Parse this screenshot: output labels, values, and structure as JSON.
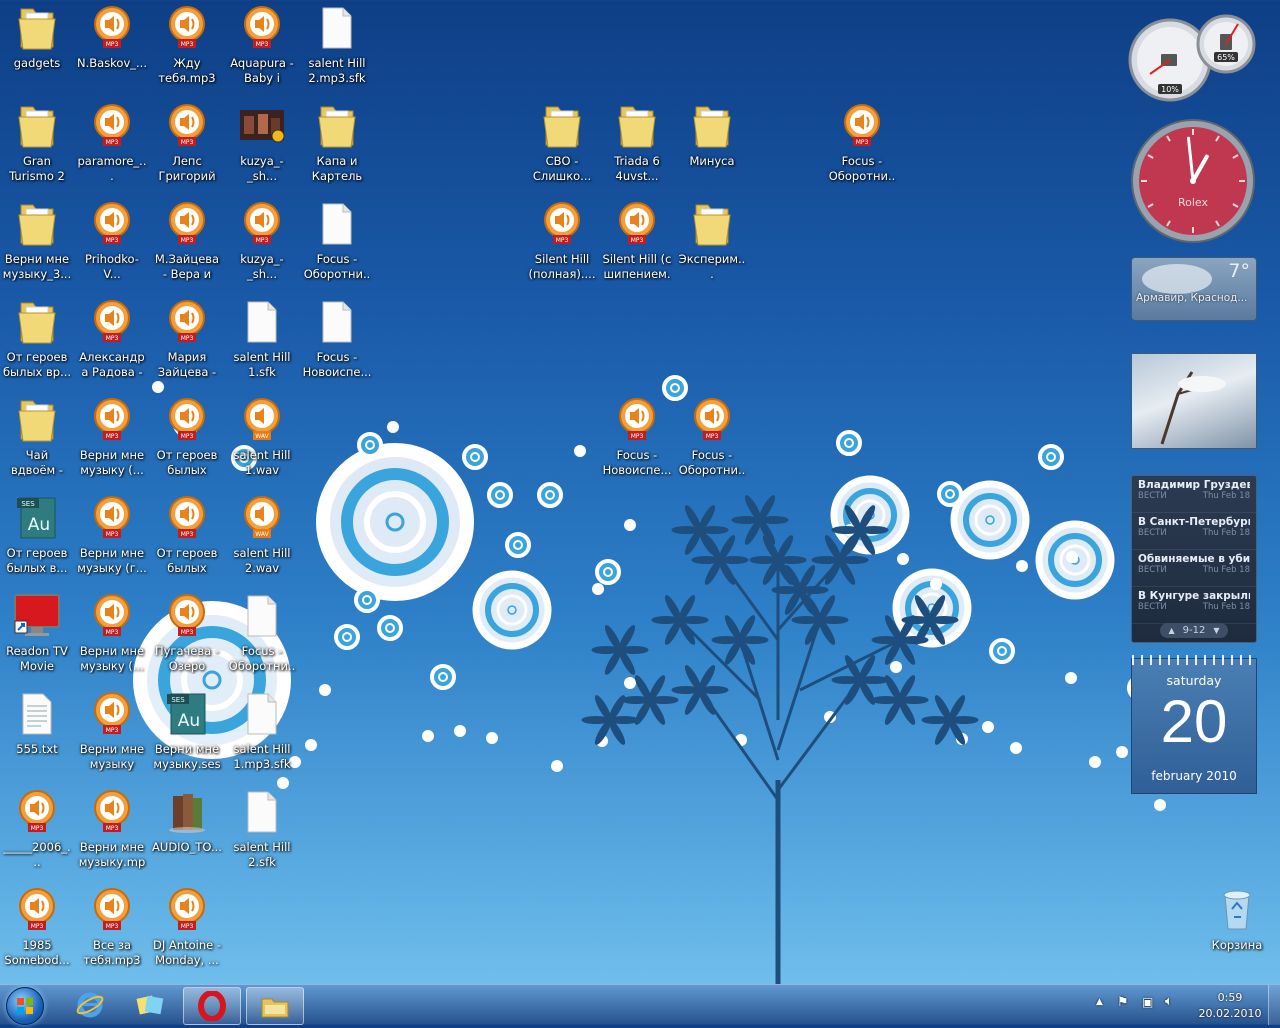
{
  "desktop": {
    "icons": [
      {
        "label": "gadgets",
        "type": "folder"
      },
      {
        "label": "N.Baskov_...",
        "type": "mp3"
      },
      {
        "label": "Жду тебя.mp3",
        "type": "mp3"
      },
      {
        "label": "Aquapura - Baby i thin...",
        "type": "mp3"
      },
      {
        "label": "salent Hill 2.mp3.sfk",
        "type": "file"
      },
      {
        "label": "Gran Turismo 2 [...",
        "type": "folder"
      },
      {
        "label": "paramore_...",
        "type": "mp3"
      },
      {
        "label": "Лепс Григорий -...",
        "type": "mp3"
      },
      {
        "label": "kuzya_-_sh...",
        "type": "video"
      },
      {
        "label": "Капа и Картель",
        "type": "folder"
      },
      {
        "label": "СВО - Слишко...",
        "type": "folder"
      },
      {
        "label": "Triada 6 4uvst...",
        "type": "folder"
      },
      {
        "label": "Минуса",
        "type": "folder"
      },
      {
        "label": "Focus - Оборотни...",
        "type": "mp3"
      },
      {
        "label": "Верни мне музыку_3...",
        "type": "folder"
      },
      {
        "label": "Prihodko-V...",
        "type": "mp3"
      },
      {
        "label": "М.Зайцева - Вера и лю...",
        "type": "mp3"
      },
      {
        "label": "kuzya_-_sh...",
        "type": "mp3"
      },
      {
        "label": "Focus - Оборотни...",
        "type": "file"
      },
      {
        "label": "Silent Hill (полная)....",
        "type": "mp3"
      },
      {
        "label": "Silent Hill (с шипением...",
        "type": "mp3"
      },
      {
        "label": "Эксперим...",
        "type": "folder"
      },
      {
        "label": "От героев былых вр...",
        "type": "folder"
      },
      {
        "label": "Александра Радова - ...",
        "type": "mp3"
      },
      {
        "label": "Мария Зайцева - ...",
        "type": "mp3"
      },
      {
        "label": "salent Hill 1.sfk",
        "type": "file"
      },
      {
        "label": "Focus - Новоиспе...",
        "type": "file"
      },
      {
        "label": "Чай вдвоём - День ро...",
        "type": "folder"
      },
      {
        "label": "Верни мне музыку (...",
        "type": "mp3"
      },
      {
        "label": "От героев былых вре...",
        "type": "mp3"
      },
      {
        "label": "salent Hill 1.wav",
        "type": "wav"
      },
      {
        "label": "Focus - Новоиспе...",
        "type": "mp3"
      },
      {
        "label": "Focus - Оборотни...",
        "type": "mp3"
      },
      {
        "label": "От героев былых в...",
        "type": "ses"
      },
      {
        "label": "Верни мне музыку (г...",
        "type": "mp3"
      },
      {
        "label": "От героев былых вре...",
        "type": "mp3"
      },
      {
        "label": "salent Hill 2.wav",
        "type": "wav"
      },
      {
        "label": "Readon TV Movie Rad...",
        "type": "app"
      },
      {
        "label": "Верни мне музыку (...",
        "type": "mp3"
      },
      {
        "label": "Пугачева - Озеро над...",
        "type": "mp3"
      },
      {
        "label": "Focus - Оборотни...",
        "type": "file"
      },
      {
        "label": "555.txt",
        "type": "txt"
      },
      {
        "label": "Верни мне музыку (го...",
        "type": "mp3"
      },
      {
        "label": "Верни мне музыку.ses",
        "type": "ses"
      },
      {
        "label": "salent Hill 1.mp3.sfk",
        "type": "file"
      },
      {
        "label": "_____2006_...",
        "type": "mp3"
      },
      {
        "label": "Верни мне музыку.mp3",
        "type": "mp3"
      },
      {
        "label": "AUDIO_TO...",
        "type": "books"
      },
      {
        "label": "salent Hill 2.sfk",
        "type": "file"
      },
      {
        "label": "1985 Somebod...",
        "type": "mp3"
      },
      {
        "label": "Все за тебя.mp3",
        "type": "mp3"
      },
      {
        "label": "DJ Antoine - Monday, ...",
        "type": "mp3"
      },
      {
        "label": "Корзина",
        "type": "recycle"
      }
    ]
  },
  "gadgets": {
    "cpu_meter": {
      "cpu_label": "10%",
      "ram_label": "65%",
      "cpu_value": 10,
      "ram_value": 65
    },
    "clock": {
      "brand": "Rolex",
      "hour": 0,
      "minute": 59
    },
    "weather": {
      "temp": "7°",
      "location": "Армавир, Краснод..."
    },
    "news": {
      "items": [
        {
          "title": "Владимир Груздев:...",
          "source": "ВЕСТИ",
          "date": "Thu Feb 18"
        },
        {
          "title": "В Санкт-Петербурге...",
          "source": "ВЕСТИ",
          "date": "Thu Feb 18"
        },
        {
          "title": "Обвиняемые в уби...",
          "source": "ВЕСТИ",
          "date": "Thu Feb 18"
        },
        {
          "title": "В Кунгуре закрыли ...",
          "source": "ВЕСТИ",
          "date": "Thu Feb 18"
        }
      ],
      "pager": "9-12"
    },
    "calendar": {
      "weekday": "saturday",
      "day": "20",
      "month_year": "february 2010"
    }
  },
  "taskbar": {
    "time": "0:59",
    "date": "20.02.2010",
    "pinned": [
      {
        "name": "internet-explorer",
        "icon": "ie-icon"
      },
      {
        "name": "windows-live",
        "icon": "live-messenger-icon"
      },
      {
        "name": "opera",
        "icon": "opera-icon"
      },
      {
        "name": "explorer",
        "icon": "folder-icon"
      }
    ]
  },
  "colors": {
    "accent": "#1a5aa8",
    "mp3": "#e9821a",
    "clock_face": "#c03850"
  }
}
